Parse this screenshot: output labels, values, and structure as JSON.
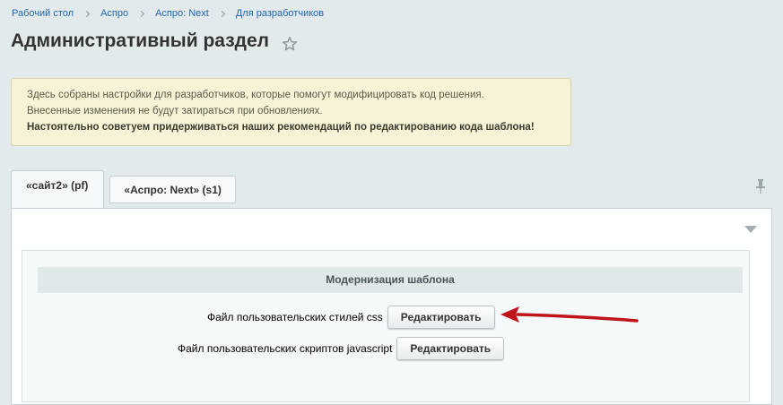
{
  "breadcrumb": {
    "items": [
      "Рабочий стол",
      "Аспро",
      "Аспро: Next",
      "Для разработчиков"
    ]
  },
  "header": {
    "title": "Административный раздел"
  },
  "notice": {
    "line1": "Здесь собраны настройки для разработчиков, которые помогут модифицировать код решения.",
    "line2": "Внесенные изменения не будут затираться при обновлениях.",
    "line3": "Настоятельно советуем придерживаться наших рекомендаций по редактированию кода шаблона!"
  },
  "tabs": [
    {
      "label": "«сайт2» (pf)",
      "active": true
    },
    {
      "label": "«Аспро: Next» (s1)",
      "active": false
    }
  ],
  "section": {
    "title": "Модернизация шаблона",
    "rows": [
      {
        "label": "Файл пользовательских стилей css",
        "button": "Редактировать"
      },
      {
        "label": "Файл пользовательских скриптов javascript",
        "button": "Редактировать"
      }
    ]
  },
  "colors": {
    "background": "#e3eaec",
    "notice_bg": "#f7f3d6",
    "link": "#2067b0",
    "annotation_arrow": "#c0141b"
  }
}
